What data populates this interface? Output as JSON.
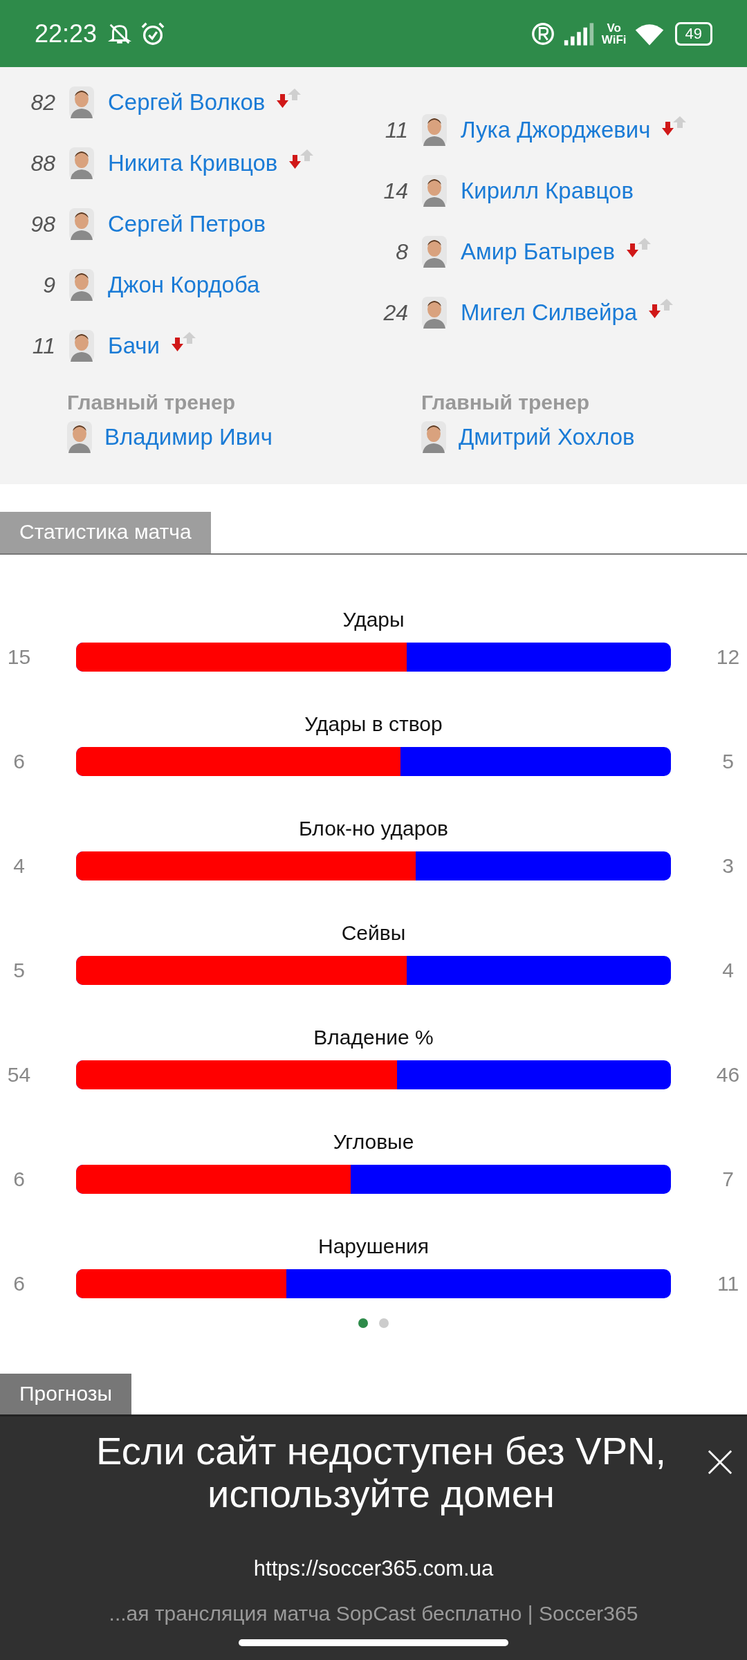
{
  "status_bar": {
    "time": "22:23",
    "network": "Vo\nWiFi",
    "battery": "49"
  },
  "lineups": {
    "home": [
      {
        "number": "82",
        "name": "Сергей Волков",
        "substituted": true
      },
      {
        "number": "88",
        "name": "Никита Кривцов",
        "substituted": true
      },
      {
        "number": "98",
        "name": "Сергей Петров",
        "substituted": false
      },
      {
        "number": "9",
        "name": "Джон Кордоба",
        "substituted": false
      },
      {
        "number": "11",
        "name": "Бачи",
        "substituted": true
      }
    ],
    "away": [
      {
        "number": "11",
        "name": "Лука Джорджевич",
        "substituted": true
      },
      {
        "number": "14",
        "name": "Кирилл Кравцов",
        "substituted": false
      },
      {
        "number": "8",
        "name": "Амир Батырев",
        "substituted": true
      },
      {
        "number": "24",
        "name": "Мигел Силвейра",
        "substituted": true
      }
    ],
    "coaches": [
      {
        "label": "Главный тренер",
        "name": "Владимир Ивич"
      },
      {
        "label": "Главный тренер",
        "name": "Дмитрий Хохлов"
      }
    ]
  },
  "stats_tab": "Статистика матча",
  "stats": [
    {
      "title": "Удары",
      "home": "15",
      "away": "12",
      "level": 0.556
    },
    {
      "title": "Удары в створ",
      "home": "6",
      "away": "5",
      "level": 0.545
    },
    {
      "title": "Блок-но ударов",
      "home": "4",
      "away": "3",
      "level": 0.571
    },
    {
      "title": "Сейвы",
      "home": "5",
      "away": "4",
      "level": 0.556
    },
    {
      "title": "Владение %",
      "home": "54",
      "away": "46",
      "level": 0.54
    },
    {
      "title": "Угловые",
      "home": "6",
      "away": "7",
      "level": 0.462
    },
    {
      "title": "Нарушения",
      "home": "6",
      "away": "11",
      "level": 0.353
    }
  ],
  "pager": [
    {
      "selected": true
    },
    {
      "selected": false
    }
  ],
  "predictions_tab": "Прогнозы",
  "banner": {
    "headline": "Если сайт недоступен без VPN, используйте домен",
    "url": "https://soccer365.com.ua",
    "page_title": "...ая трансляция матча SopCast бесплатно | Soccer365"
  }
}
